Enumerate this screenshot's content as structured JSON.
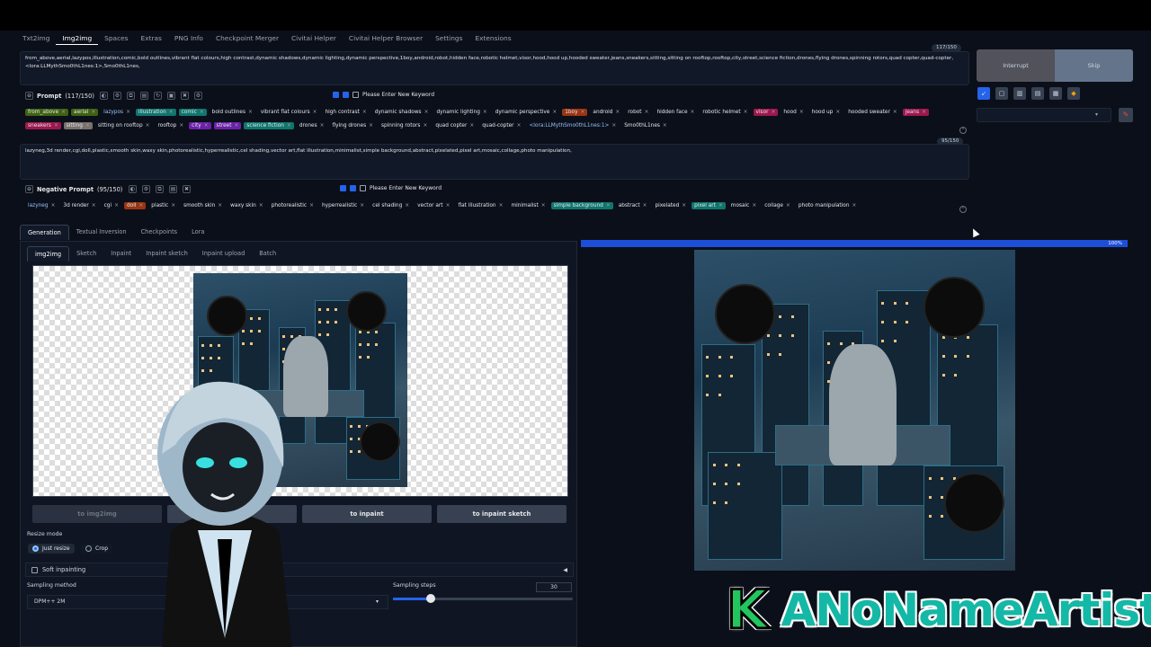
{
  "tabs": [
    "Txt2img",
    "Img2img",
    "Spaces",
    "Extras",
    "PNG Info",
    "Checkpoint Merger",
    "Civitai Helper",
    "Civitai Helper Browser",
    "Settings",
    "Extensions"
  ],
  "active_tab": "Img2img",
  "prompt": {
    "text": "from_above,aerial,lazypos,illustration,comic,bold outlines,vibrant flat colours,high contrast,dynamic shadows,dynamic lighting,dynamic perspective,1boy,android,robot,hidden face,robotic helmet,visor,hood,hood up,hooded sweater,jeans,sneakers,sitting,sitting on rooftop,rooftop,city,street,science fiction,drones,flying drones,spinning rotors,quad copter,quad-copter,<lora:LLMythSmo0thL1nes:1>,Smo0thL1nes,",
    "counter": "117/150",
    "label": "Prompt",
    "count": "(117/150)",
    "keyword_label": "Please Enter New Keyword",
    "tags_row1": [
      {
        "t": "from_above",
        "c": "green"
      },
      {
        "t": "aerial",
        "c": "green"
      },
      {
        "t": "lazypos",
        "c": "blue"
      },
      {
        "t": "illustration",
        "c": "teal"
      },
      {
        "t": "comic",
        "c": "teal"
      },
      {
        "t": "bold outlines",
        "c": ""
      },
      {
        "t": "vibrant flat colours",
        "c": ""
      },
      {
        "t": "high contrast",
        "c": ""
      },
      {
        "t": "dynamic shadows",
        "c": ""
      },
      {
        "t": "dynamic lighting",
        "c": ""
      },
      {
        "t": "dynamic perspective",
        "c": ""
      },
      {
        "t": "1boy",
        "c": "orange"
      },
      {
        "t": "android",
        "c": ""
      },
      {
        "t": "robot",
        "c": ""
      },
      {
        "t": "hidden face",
        "c": ""
      },
      {
        "t": "robotic helmet",
        "c": ""
      },
      {
        "t": "visor",
        "c": "pink"
      },
      {
        "t": "hood",
        "c": ""
      },
      {
        "t": "hood up",
        "c": ""
      },
      {
        "t": "hooded sweater",
        "c": ""
      },
      {
        "t": "jeans",
        "c": "pink"
      }
    ],
    "tags_row2": [
      {
        "t": "sneakers",
        "c": "pink"
      },
      {
        "t": "sitting",
        "c": "tan"
      },
      {
        "t": "sitting on rooftop",
        "c": ""
      },
      {
        "t": "rooftop",
        "c": ""
      },
      {
        "t": "city",
        "c": "purple"
      },
      {
        "t": "street",
        "c": "purple"
      },
      {
        "t": "science fiction",
        "c": "teal"
      },
      {
        "t": "drones",
        "c": ""
      },
      {
        "t": "flying drones",
        "c": ""
      },
      {
        "t": "spinning rotors",
        "c": ""
      },
      {
        "t": "quad copter",
        "c": ""
      },
      {
        "t": "quad-copter",
        "c": ""
      },
      {
        "t": "<lora:LLMythSmo0thL1nes:1>",
        "c": "blue"
      },
      {
        "t": "Smo0thL1nes",
        "c": ""
      }
    ]
  },
  "negative": {
    "text": "lazyneg,3d render,cgi,doll,plastic,smooth skin,waxy skin,photorealistic,hyperrealistic,cel shading,vector art,flat illustration,minimalist,simple background,abstract,pixelated,pixel art,mosaic,collage,photo manipulation,",
    "counter": "95/150",
    "label": "Negative Prompt",
    "count": "(95/150)",
    "keyword_label": "Please Enter New Keyword",
    "tags": [
      {
        "t": "lazyneg",
        "c": "blue"
      },
      {
        "t": "3d render",
        "c": ""
      },
      {
        "t": "cgi",
        "c": ""
      },
      {
        "t": "doll",
        "c": "orange"
      },
      {
        "t": "plastic",
        "c": ""
      },
      {
        "t": "smooth skin",
        "c": ""
      },
      {
        "t": "waxy skin",
        "c": ""
      },
      {
        "t": "photorealistic",
        "c": ""
      },
      {
        "t": "hyperrealistic",
        "c": ""
      },
      {
        "t": "cel shading",
        "c": ""
      },
      {
        "t": "vector art",
        "c": ""
      },
      {
        "t": "flat illustration",
        "c": ""
      },
      {
        "t": "minimalist",
        "c": ""
      },
      {
        "t": "simple background",
        "c": "teal"
      },
      {
        "t": "abstract",
        "c": ""
      },
      {
        "t": "pixelated",
        "c": ""
      },
      {
        "t": "pixel art",
        "c": "teal"
      },
      {
        "t": "mosaic",
        "c": ""
      },
      {
        "t": "collage",
        "c": ""
      },
      {
        "t": "photo manipulation",
        "c": ""
      }
    ]
  },
  "right": {
    "interrupt": "Interrupt",
    "skip": "Skip"
  },
  "gen_tabs": [
    "Generation",
    "Textual Inversion",
    "Checkpoints",
    "Lora"
  ],
  "img_tabs": [
    "img2img",
    "Sketch",
    "Inpaint",
    "Inpaint sketch",
    "Inpaint upload",
    "Batch"
  ],
  "buttons": {
    "to_img2img": "to img2img",
    "to_inpaint": "to inpaint",
    "to_inpaint_sketch": "to inpaint sketch"
  },
  "resize_mode": {
    "label": "Resize mode",
    "selected": "Just resize",
    "other": "Crop"
  },
  "soft_inpainting": "Soft inpainting",
  "sampling_method": {
    "label": "Sampling method",
    "value": "DPM++ 2M"
  },
  "sampling_steps": {
    "label": "Sampling steps",
    "value": "30",
    "fraction": 0.21
  },
  "progress": {
    "label": "100%",
    "value": 1.0
  },
  "watermark": {
    "k": "K",
    "name": "ANoNameArtist"
  },
  "colors": {
    "accent": "#2563eb",
    "bg": "#0b0f19"
  }
}
